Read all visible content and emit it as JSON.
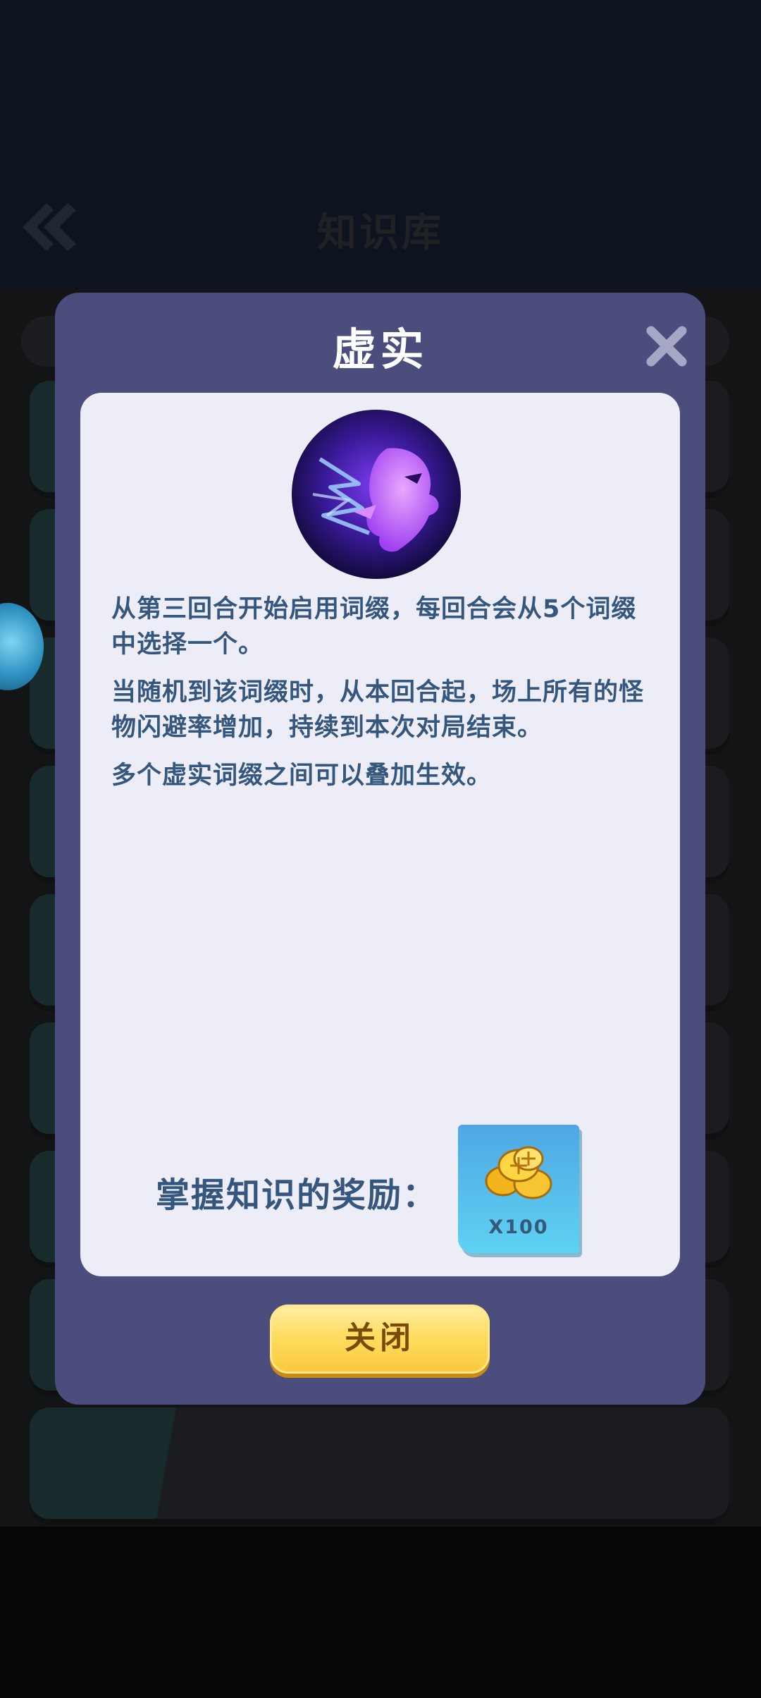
{
  "background": {
    "title": "知识库"
  },
  "modal": {
    "title": "虚实",
    "description": [
      "从第三回合开始启用词缀，每回合会从5个词缀中选择一个。",
      "当随机到该词缀时，从本回合起，场上所有的怪物闪避率增加，持续到本次对局结束。",
      "多个虚实词缀之间可以叠加生效。"
    ],
    "reward_label": "掌握知识的奖励：",
    "reward_quantity": "X100",
    "reward_icon": "gold-coins-icon",
    "close_button_label": "关闭"
  },
  "colors": {
    "modal_bg": "#4b4d7d",
    "card_bg": "#ecedf7",
    "text": "#35567d",
    "button_yellow": "#ffdd62",
    "reward_tile": "#5ed2f2"
  }
}
